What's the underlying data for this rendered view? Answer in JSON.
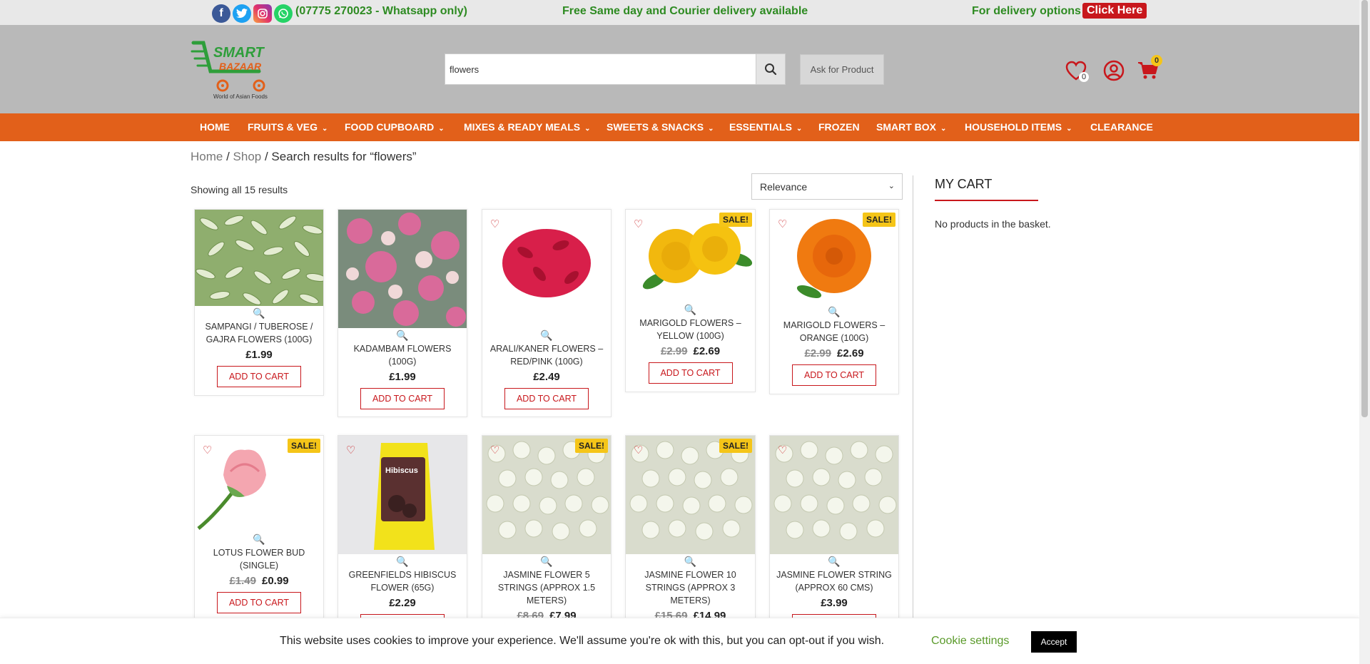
{
  "topbar": {
    "phone": "(07775 270023 - Whatsapp only)",
    "delivery": "Free Same day and Courier delivery available",
    "options": "For delivery options",
    "click_here": "Click Here"
  },
  "header": {
    "logo_text_top": "SMART",
    "logo_text_bottom": "BAZAAR",
    "logo_tagline": "World of Asian Foods",
    "search_value": "flowers",
    "ask_label": "Ask for Product",
    "wishlist_count": "0",
    "cart_count": "0"
  },
  "nav": {
    "items": [
      {
        "label": "HOME",
        "chevron": false
      },
      {
        "label": "FRUITS & VEG",
        "chevron": true
      },
      {
        "label": "FOOD CUPBOARD",
        "chevron": true
      },
      {
        "label": "MIXES & READY MEALS",
        "chevron": true
      },
      {
        "label": "SWEETS & SNACKS",
        "chevron": true
      },
      {
        "label": "ESSENTIALS",
        "chevron": true
      },
      {
        "label": "FROZEN",
        "chevron": false
      },
      {
        "label": "SMART BOX",
        "chevron": true
      },
      {
        "label": "HOUSEHOLD ITEMS",
        "chevron": true
      },
      {
        "label": "CLEARANCE",
        "chevron": false
      }
    ]
  },
  "breadcrumb": {
    "home": "Home",
    "sep1": " / ",
    "shop": "Shop",
    "sep2": " / ",
    "current": "Search results for “flowers”"
  },
  "results_count": "Showing all 15 results",
  "sort": {
    "selected": "Relevance"
  },
  "cart": {
    "title": "MY CART",
    "empty": "No products in the basket."
  },
  "add_to_cart": "ADD TO CART",
  "sale_label": "SALE!",
  "products": [
    {
      "name": "SAMPANGI / TUBEROSE / GAJRA FLOWERS (100G)",
      "price": "£1.99",
      "old_price": "",
      "sale": false,
      "img": "tuberose"
    },
    {
      "name": "KADAMBAM FLOWERS (100G)",
      "price": "£1.99",
      "old_price": "",
      "sale": false,
      "img": "kadambam"
    },
    {
      "name": "ARALI/KANER FLOWERS – RED/PINK (100G)",
      "price": "£2.49",
      "old_price": "",
      "sale": false,
      "img": "arali"
    },
    {
      "name": "MARIGOLD FLOWERS – YELLOW (100G)",
      "price": "£2.69",
      "old_price": "£2.99",
      "sale": true,
      "img": "marigold-yellow"
    },
    {
      "name": "MARIGOLD FLOWERS – ORANGE (100G)",
      "price": "£2.69",
      "old_price": "£2.99",
      "sale": true,
      "img": "marigold-orange"
    },
    {
      "name": "LOTUS FLOWER BUD (SINGLE)",
      "price": "£0.99",
      "old_price": "£1.49",
      "sale": true,
      "img": "lotus"
    },
    {
      "name": "GREENFIELDS HIBISCUS FLOWER (65G)",
      "price": "£2.29",
      "old_price": "",
      "sale": false,
      "img": "hibiscus"
    },
    {
      "name": "JASMINE FLOWER 5 STRINGS (APPROX 1.5 METERS)",
      "price": "£7.99",
      "old_price": "£8.69",
      "sale": true,
      "img": "jasmine"
    },
    {
      "name": "JASMINE FLOWER 10 STRINGS (APPROX 3 METERS)",
      "price": "£14.99",
      "old_price": "£15.69",
      "sale": true,
      "img": "jasmine"
    },
    {
      "name": "JASMINE FLOWER STRING (APPROX 60 CMS)",
      "price": "£3.99",
      "old_price": "",
      "sale": false,
      "img": "jasmine"
    }
  ],
  "cookie": {
    "text": "This website uses cookies to improve your experience. We'll assume you're ok with this, but you can opt-out if you wish.",
    "settings": "Cookie settings",
    "accept": "Accept"
  }
}
